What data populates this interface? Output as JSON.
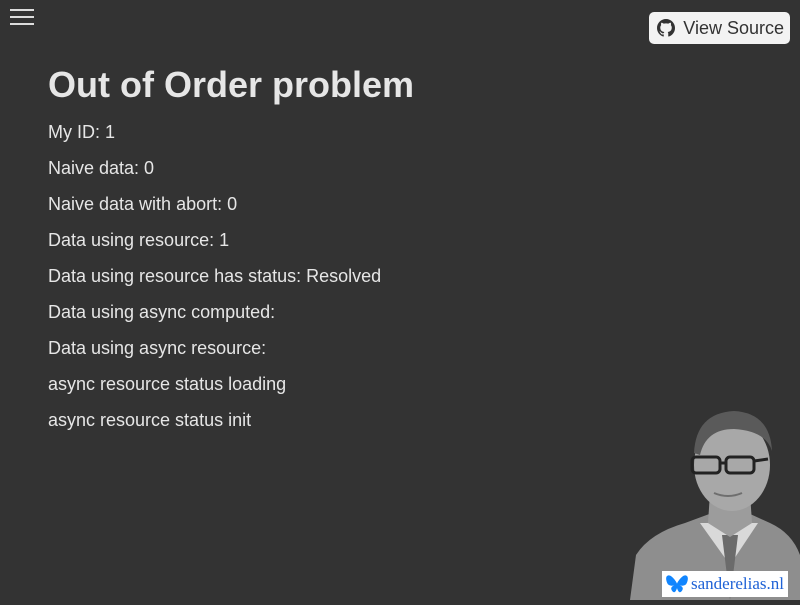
{
  "header": {
    "menu_icon": "hamburger-menu-icon",
    "view_source": {
      "label": "View Source",
      "icon": "github-icon"
    }
  },
  "main": {
    "title": "Out of Order problem",
    "lines": [
      "My ID: 1",
      "Naive data: 0",
      "Naive data with abort: 0",
      "Data using resource: 1",
      "Data using resource has status: Resolved",
      "Data using async computed:",
      "Data using async resource:",
      "async resource status loading",
      "async resource status init"
    ]
  },
  "footer": {
    "portrait_icon": "author-portrait",
    "site_badge": {
      "icon": "butterfly-icon",
      "label": "sanderelias.nl",
      "color": "#1f62d6"
    }
  },
  "colors": {
    "background": "#333333",
    "text": "#e6e6e6",
    "button_bg": "#f3f3f3"
  }
}
